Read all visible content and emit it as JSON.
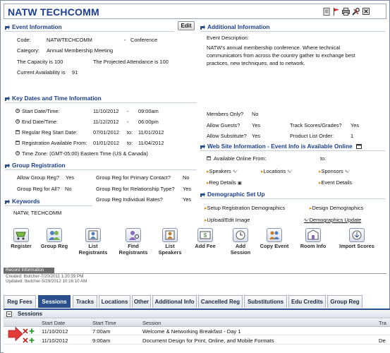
{
  "window": {
    "title": "NATW TECHCOMM"
  },
  "toolbar_icons": [
    "document-icon",
    "flag-icon",
    "print-icon",
    "tools-icon",
    "close-icon"
  ],
  "event_info": {
    "header": "Event Information",
    "edit_label": "Edit",
    "code_label": "Code:",
    "code_value": "NATWTECHCOMM",
    "dash": "-",
    "type": "Conference",
    "category_label": "Category:",
    "category_value": "Annual Membership Meeting",
    "capacity": "The Capacity is 100",
    "projected": "The Projected Attendance is 100",
    "availability": "Current Availability is",
    "availability_value": "91"
  },
  "additional_info": {
    "header": "Additional Information",
    "desc_label": "Event Description:",
    "desc_text": [
      "NATW's annual membership conference. Where technical",
      "communicators from across the country gather to exchange best",
      "practices, new techniques, and to network."
    ],
    "members_only_label": "Members Only?",
    "members_only": "No",
    "allow_guests_label": "Allow Guests?",
    "allow_guests": "Yes",
    "track_scores_label": "Track Scores/Grades?",
    "track_scores": "Yes",
    "allow_sub_label": "Allow Substitute?",
    "allow_sub": "Yes",
    "product_order_label": "Product List Order:",
    "product_order": "1"
  },
  "key_dates": {
    "header": "Key Dates and Time Information",
    "start_label": "Start Date/Time:",
    "start_date": "11/10/2012",
    "start_time": "09:00am",
    "end_label": "End Date/Time:",
    "end_date": "11/12/2012",
    "end_time": "06:00pm",
    "reg_label": "Regular Reg Start Date:",
    "reg_from": "07/01/2012",
    "to": "to:",
    "reg_to": "11/01/2012",
    "avail_label": "Registration Available From:",
    "avail_from": "01/01/2012",
    "avail_to": "11/04/2012",
    "tz": "Time Zone: (GMT-05:00) Eastern Time (US & Canada)"
  },
  "web_info": {
    "header": "Web Site Information - Event Info is Available Online",
    "online_from": "Available Online From:",
    "to": "to:",
    "speakers": "Speakers",
    "locations": "Locations",
    "sponsors": "Sponsors",
    "reg_details": "Reg Details",
    "event_details": "Event Details"
  },
  "group_reg": {
    "header": "Group Registration",
    "allow_label": "Allow Group Reg?",
    "allow_value": "Yes",
    "primary_label": "Group Reg for Primary Contact?",
    "primary_value": "No",
    "all_label": "Group Reg for All?",
    "all_value": "No",
    "relationship_label": "Group Reg for Relationship Type?",
    "relationship_value": "Yes",
    "rates_label": "Group Reg Individual Rates?",
    "rates_value": "Yes"
  },
  "keywords": {
    "header": "Keywords",
    "value": "NATW, TECHCOMM"
  },
  "demographic": {
    "header": "Demographic Set Up",
    "setup": "Setup Registration Demographics",
    "design": "Design Demographics",
    "upload": "Upload/Edit Image",
    "update": "Demographics Update"
  },
  "actions": [
    {
      "l1": "Register",
      "l2": ""
    },
    {
      "l1": "Group Reg",
      "l2": ""
    },
    {
      "l1": "List",
      "l2": "Registrants"
    },
    {
      "l1": "Find",
      "l2": "Registrants"
    },
    {
      "l1": "List",
      "l2": "Speakers"
    },
    {
      "l1": "Add Fee",
      "l2": ""
    },
    {
      "l1": "Add",
      "l2": "Session"
    },
    {
      "l1": "Copy Event",
      "l2": ""
    },
    {
      "l1": "Room Info",
      "l2": ""
    },
    {
      "l1": "Import Scores",
      "l2": ""
    }
  ],
  "record": {
    "header": "Record Information",
    "created": "Created: tbutcher-7/20/2011 1:20:39 PM",
    "updated": "Updated: tbutcher-5/29/2012 10:16:10 AM"
  },
  "tabs": [
    "Reg Fees",
    "Sessions",
    "Tracks",
    "Locations",
    "Other",
    "Additional Info",
    "Cancelled Reg",
    "Substitutions",
    "Edu Credits",
    "Group Reg"
  ],
  "active_tab": "Sessions",
  "sessions": {
    "header": "Sessions",
    "columns": [
      "Start Date",
      "Start Time",
      "Session",
      "Tra"
    ],
    "rows": [
      {
        "date": "11/10/2012",
        "time": "7:00am",
        "session": "Welcome & Networking Breakfast - Day 1",
        "track": ""
      },
      {
        "date": "11/10/2012",
        "time": "9:00am",
        "session": "Document Design for Print, Online, and Mobile Formats",
        "track": "De"
      }
    ]
  }
}
